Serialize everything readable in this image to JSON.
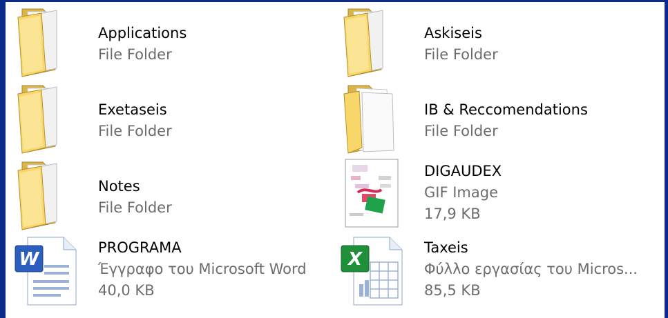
{
  "items": [
    {
      "name": "Applications",
      "type": "File Folder",
      "size": "",
      "icon": "folder-icon"
    },
    {
      "name": "Askiseis",
      "type": "File Folder",
      "size": "",
      "icon": "folder-icon"
    },
    {
      "name": "Exetaseis",
      "type": "File Folder",
      "size": "",
      "icon": "folder-icon"
    },
    {
      "name": "IB & Reccomendations",
      "type": "File Folder",
      "size": "",
      "icon": "open-folder-icon"
    },
    {
      "name": "Notes",
      "type": "File Folder",
      "size": "",
      "icon": "folder-icon"
    },
    {
      "name": "DIGAUDEX",
      "type": "GIF Image",
      "size": "17,9 KB",
      "icon": "gif-thumbnail-icon"
    },
    {
      "name": "PROGRAMA",
      "type": "Έγγραφο του Microsoft Word",
      "size": "40,0 KB",
      "icon": "word-document-icon"
    },
    {
      "name": "Taxeis",
      "type": "Φύλλο εργασίας του Micros...",
      "size": "85,5 KB",
      "icon": "excel-worksheet-icon"
    }
  ]
}
